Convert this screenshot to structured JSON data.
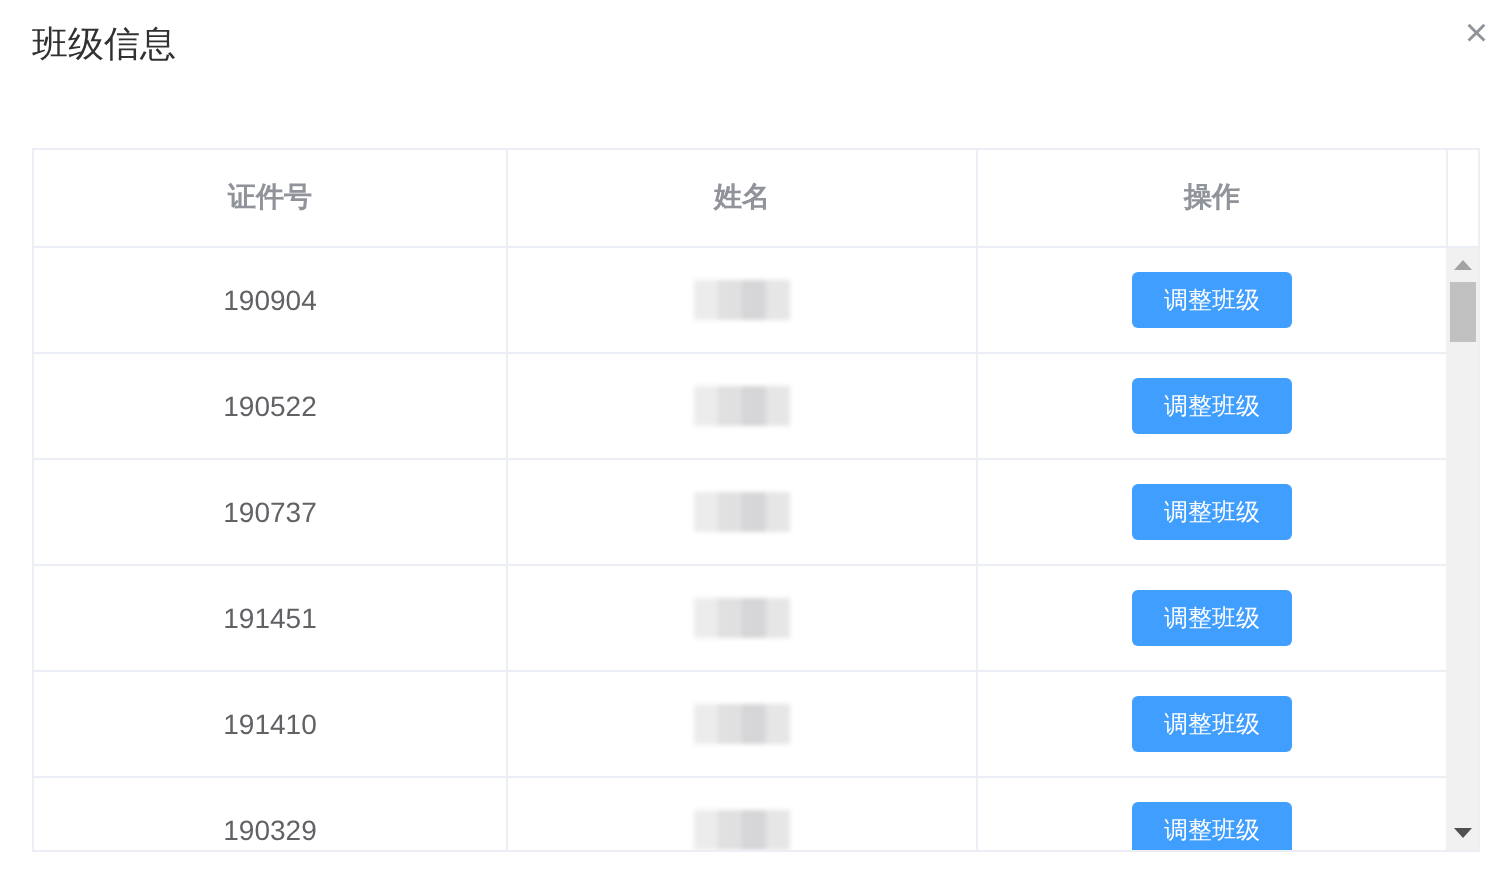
{
  "dialog": {
    "title": "班级信息",
    "close": "×"
  },
  "table": {
    "columns": [
      "证件号",
      "姓名",
      "操作"
    ],
    "rows": [
      {
        "id": "190904",
        "name": {
          "kind": "redacted"
        },
        "action": "调整班级"
      },
      {
        "id": "190522",
        "name": {
          "kind": "redacted"
        },
        "action": "调整班级"
      },
      {
        "id": "190737",
        "name": {
          "kind": "redacted"
        },
        "action": "调整班级"
      },
      {
        "id": "191451",
        "name": {
          "kind": "redacted"
        },
        "action": "调整班级"
      },
      {
        "id": "191410",
        "name": {
          "kind": "redacted"
        },
        "action": "调整班级"
      },
      {
        "id": "190329",
        "name": {
          "kind": "redacted"
        },
        "action": "调整班级"
      }
    ]
  }
}
